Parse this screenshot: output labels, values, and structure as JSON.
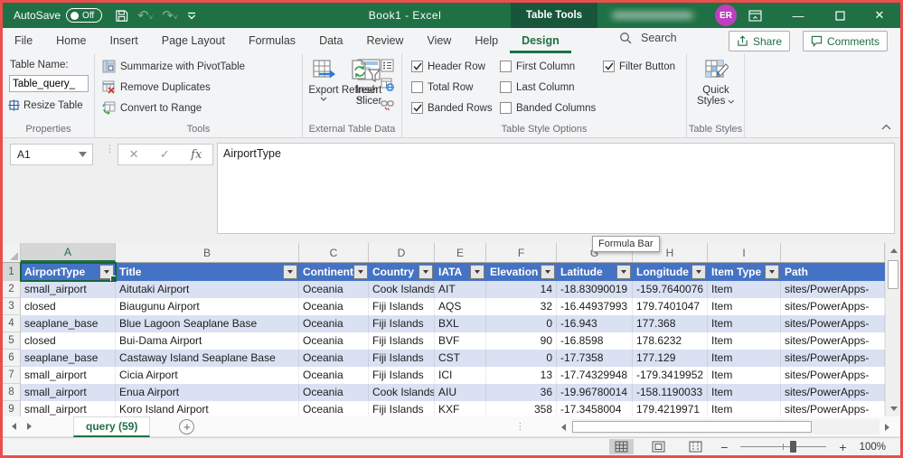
{
  "titlebar": {
    "autosave_label": "AutoSave",
    "autosave_state": "Off",
    "title": "Book1 - Excel",
    "contextual_tab": "Table Tools",
    "user_initials": "ER"
  },
  "ribbon_tabs": {
    "tabs": [
      {
        "label": "File",
        "active": false
      },
      {
        "label": "Home",
        "active": false
      },
      {
        "label": "Insert",
        "active": false
      },
      {
        "label": "Page Layout",
        "active": false
      },
      {
        "label": "Formulas",
        "active": false
      },
      {
        "label": "Data",
        "active": false
      },
      {
        "label": "Review",
        "active": false
      },
      {
        "label": "View",
        "active": false
      },
      {
        "label": "Help",
        "active": false
      },
      {
        "label": "Design",
        "active": true
      }
    ],
    "search_label": "Search",
    "share_label": "Share",
    "comments_label": "Comments"
  },
  "ribbon": {
    "properties": {
      "table_name_label": "Table Name:",
      "table_name_value": "Table_query_",
      "resize_table_label": "Resize Table",
      "group_label": "Properties"
    },
    "tools": {
      "summarize_label": "Summarize with PivotTable",
      "remove_duplicates_label": "Remove Duplicates",
      "convert_to_range_label": "Convert to Range",
      "insert_slicer_line1": "Insert",
      "insert_slicer_line2": "Slicer",
      "group_label": "Tools"
    },
    "external": {
      "export_label": "Export",
      "refresh_label": "Refresh",
      "group_label": "External Table Data"
    },
    "style_options": {
      "group_label": "Table Style Options",
      "checkboxes": [
        {
          "label": "Header Row",
          "checked": true
        },
        {
          "label": "Total Row",
          "checked": false
        },
        {
          "label": "Banded Rows",
          "checked": true
        },
        {
          "label": "First Column",
          "checked": false
        },
        {
          "label": "Last Column",
          "checked": false
        },
        {
          "label": "Banded Columns",
          "checked": false
        },
        {
          "label": "Filter Button",
          "checked": true
        }
      ]
    },
    "table_styles": {
      "quick_styles_line1": "Quick",
      "quick_styles_line2": "Styles",
      "group_label": "Table Styles"
    }
  },
  "formula_bar": {
    "name_box": "A1",
    "fx_label": "fx",
    "content": "AirportType",
    "tooltip": "Formula Bar"
  },
  "grid": {
    "column_letters": [
      "A",
      "B",
      "C",
      "D",
      "E",
      "F",
      "G",
      "H",
      "I",
      ""
    ],
    "header_row_number": "1",
    "table_headers": [
      "AirportType",
      "Title",
      "Continent",
      "Country",
      "IATA",
      "Elevation",
      "Latitude",
      "Longitude",
      "Item Type",
      "Path"
    ],
    "rows": [
      {
        "n": "2",
        "cells": [
          "small_airport",
          "Aitutaki Airport",
          "Oceania",
          "Cook Islands",
          "AIT",
          "14",
          "-18.83090019",
          "-159.7640076",
          "Item",
          "sites/PowerApps-"
        ]
      },
      {
        "n": "3",
        "cells": [
          "closed",
          "Biaugunu Airport",
          "Oceania",
          "Fiji Islands",
          "AQS",
          "32",
          "-16.44937993",
          "179.7401047",
          "Item",
          "sites/PowerApps-"
        ]
      },
      {
        "n": "4",
        "cells": [
          "seaplane_base",
          "Blue Lagoon Seaplane Base",
          "Oceania",
          "Fiji Islands",
          "BXL",
          "0",
          "-16.943",
          "177.368",
          "Item",
          "sites/PowerApps-"
        ]
      },
      {
        "n": "5",
        "cells": [
          "closed",
          "Bui-Dama Airport",
          "Oceania",
          "Fiji Islands",
          "BVF",
          "90",
          "-16.8598",
          "178.6232",
          "Item",
          "sites/PowerApps-"
        ]
      },
      {
        "n": "6",
        "cells": [
          "seaplane_base",
          "Castaway Island Seaplane Base",
          "Oceania",
          "Fiji Islands",
          "CST",
          "0",
          "-17.7358",
          "177.129",
          "Item",
          "sites/PowerApps-"
        ]
      },
      {
        "n": "7",
        "cells": [
          "small_airport",
          "Cicia Airport",
          "Oceania",
          "Fiji Islands",
          "ICI",
          "13",
          "-17.74329948",
          "-179.3419952",
          "Item",
          "sites/PowerApps-"
        ]
      },
      {
        "n": "8",
        "cells": [
          "small_airport",
          "Enua Airport",
          "Oceania",
          "Cook Islands",
          "AIU",
          "36",
          "-19.96780014",
          "-158.1190033",
          "Item",
          "sites/PowerApps-"
        ]
      },
      {
        "n": "9",
        "cells": [
          "small_airport",
          "Koro Island Airport",
          "Oceania",
          "Fiji Islands",
          "KXF",
          "358",
          "-17.3458004",
          "179.4219971",
          "Item",
          "sites/PowerApps-"
        ]
      }
    ]
  },
  "sheet_bar": {
    "active_tab": "query (59)"
  },
  "status_bar": {
    "zoom_level": "100%"
  },
  "colors": {
    "excel_green": "#1F7145",
    "contextual_dark_green": "#17563A",
    "table_header_blue": "#4472C4",
    "banded_row_blue": "#D9E1F2",
    "user_badge_magenta": "#BF3FBF",
    "screenshot_border_red": "#EA4E4D"
  }
}
